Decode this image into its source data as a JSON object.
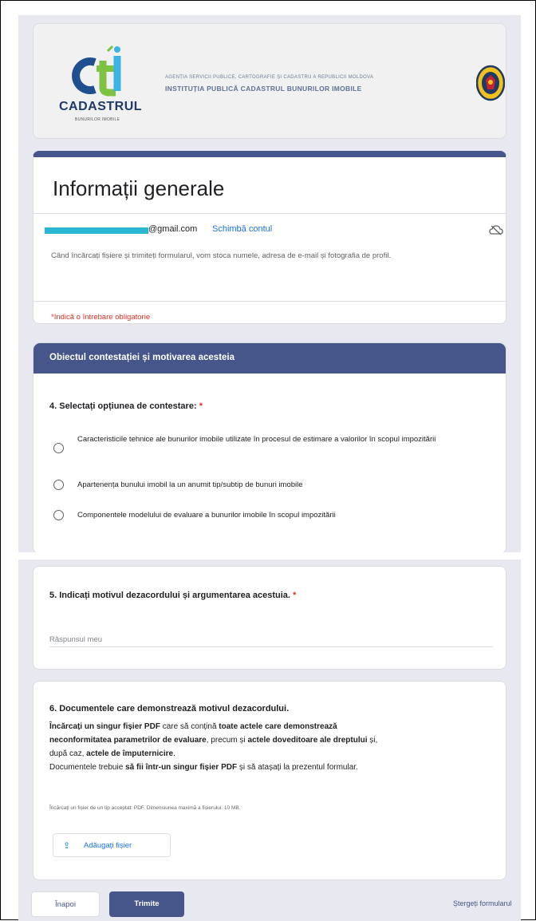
{
  "banner": {
    "logo_word": "CADASTRUL",
    "logo_sub": "BUNURILOR IMOBILE",
    "agency_line1": "AGENȚIA SERVICII PUBLICE, CARTOGRAFIE ȘI CADASTRU A REPUBLICII MOLDOVA",
    "agency_line2": "INSTITUȚIA PUBLICĂ CADASTRUL BUNURILOR IMOBILE"
  },
  "info": {
    "title": "Informații generale",
    "email_suffix": "@gmail.com",
    "switch_account": "Schimbă contul",
    "notice": "Când încărcați fișiere și trimiteți formularul, vom stoca numele, adresa de e-mail și fotografia de profil.",
    "required_note": "*Indică o întrebare obligatorie"
  },
  "section": {
    "title": "Obiectul contestației și motivarea acesteia",
    "q4_label": "4. Selectați opțiunea de contestare:",
    "required_star": "*",
    "options": [
      "Caracteristicile tehnice ale bunurilor imobile utilizate în procesul de estimare a valorilor în scopul impozitării",
      "Apartenența bunului imobil la un anumit tip/subtip de bunuri imobile",
      "Componentele modelului de evaluare a bunurilor imobile în scopul impozitării"
    ]
  },
  "q5": {
    "label": "5. Indicați motivul dezacordului și argumentarea acestuia.",
    "required_star": "*",
    "placeholder": "Răspunsul meu"
  },
  "q6": {
    "label": "6. Documentele care demonstrează motivul dezacordului.",
    "line1_bold": "Încărcați un singur fișier PDF",
    "line1_rest": " care să conțină ",
    "line1_bold2": "toate actele care demonstrează",
    "line2_bold": "neconformitatea parametrilor de evaluare",
    "line2_rest": ", precum și ",
    "line2_bold2": "actele doveditoare ale dreptului",
    "line2_end": " și,",
    "line3_rest": "după caz, ",
    "line3_bold": "actele de împuternicire",
    "line3_end": ".",
    "line4_rest": "Documentele trebuie ",
    "line4_bold": "să fii într-un singur fișier PDF",
    "line4_end": " și să atașați la prezentul formular.",
    "hint": "Încărcați un fișier de un tip acceptat: PDF. Dimensiunea maximă a fișierului: 10 MB.",
    "upload_label": "Adăugați fișier"
  },
  "footer": {
    "back_label": "Înapoi",
    "submit_label": "Trimite",
    "clear_label": "Ștergeți formularul"
  },
  "colors": {
    "theme": "#46558a",
    "link": "#1a73e8",
    "required": "#d93025",
    "email_mask": "#29b7d3"
  },
  "icons": {
    "cloud": "cloud-off-icon",
    "upload": "upload-icon",
    "seal": "coat-of-arms-icon"
  }
}
